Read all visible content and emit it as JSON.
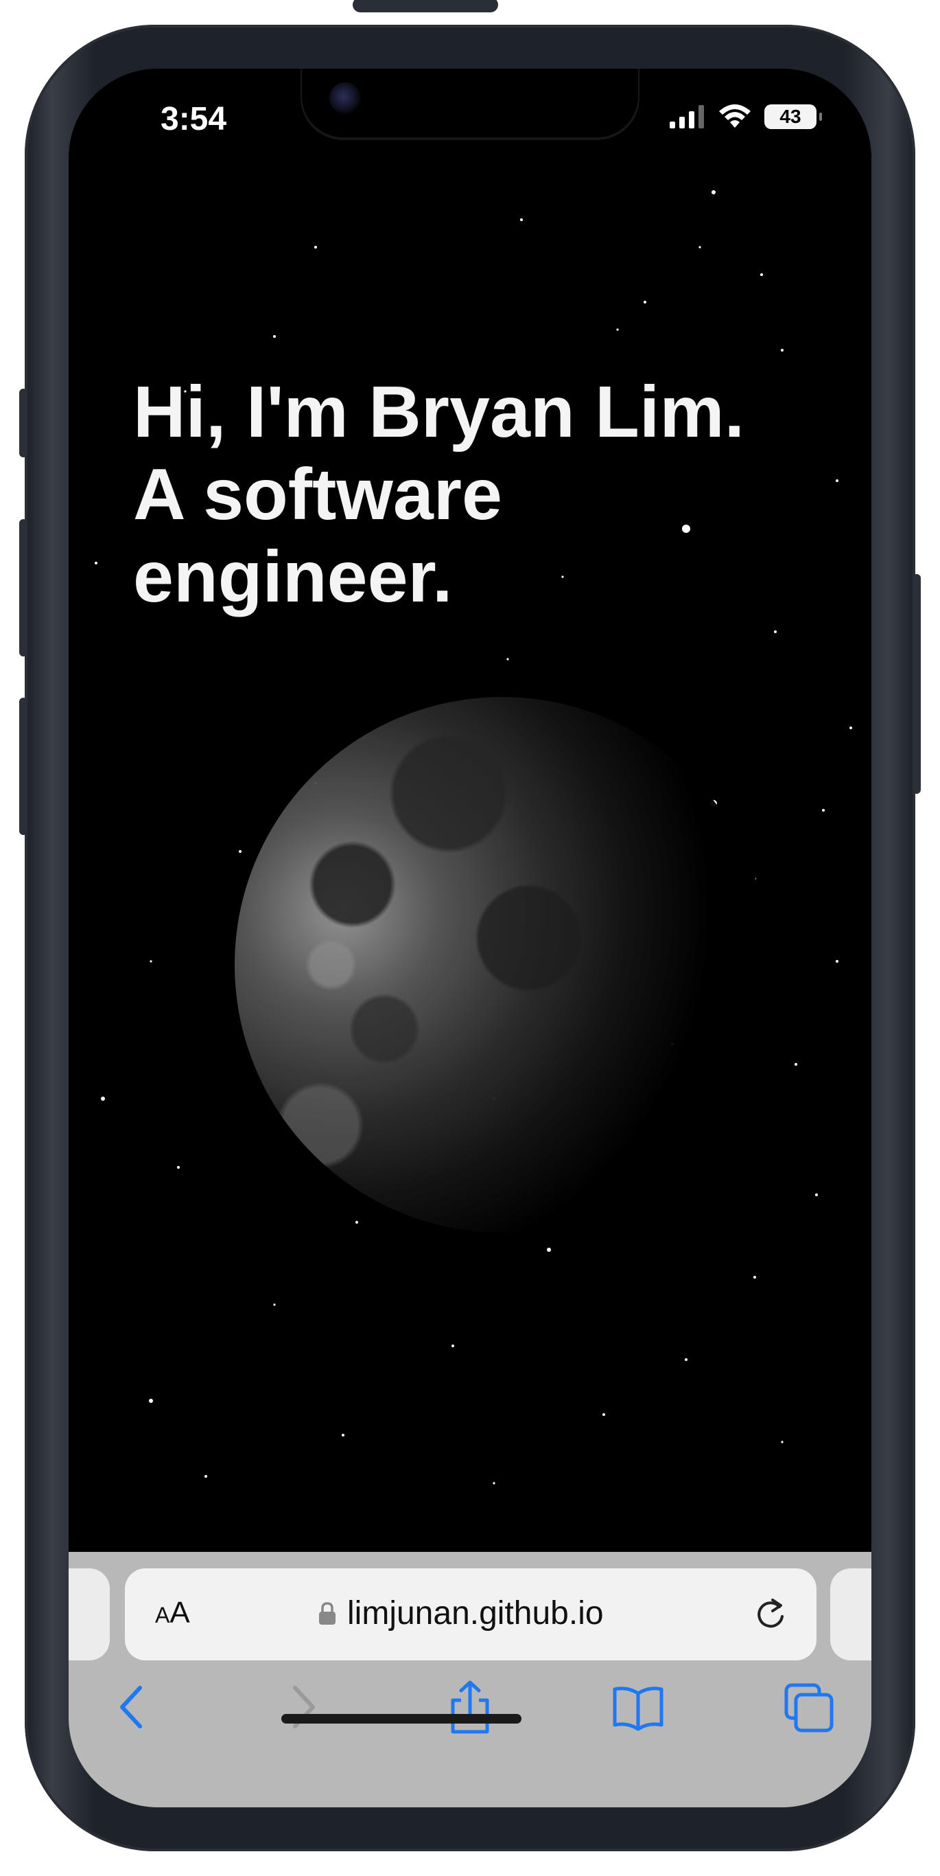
{
  "status_bar": {
    "time": "3:54",
    "battery": "43"
  },
  "hero": {
    "line1": "Hi, I'm Bryan Lim.",
    "line2": "A software",
    "line3": "engineer."
  },
  "browser": {
    "text_size_label_small": "A",
    "text_size_label_large": "A",
    "url": "limjunan.github.io",
    "icons": [
      "lock-icon",
      "reload-icon",
      "back-icon",
      "forward-icon",
      "share-icon",
      "bookmarks-icon",
      "tabs-icon"
    ]
  },
  "colors": {
    "background": "#000000",
    "text": "#f4f4f4",
    "toolbar": "#b8b8b8",
    "accent": "#1e78f0",
    "disabled": "#9a9a9a"
  }
}
